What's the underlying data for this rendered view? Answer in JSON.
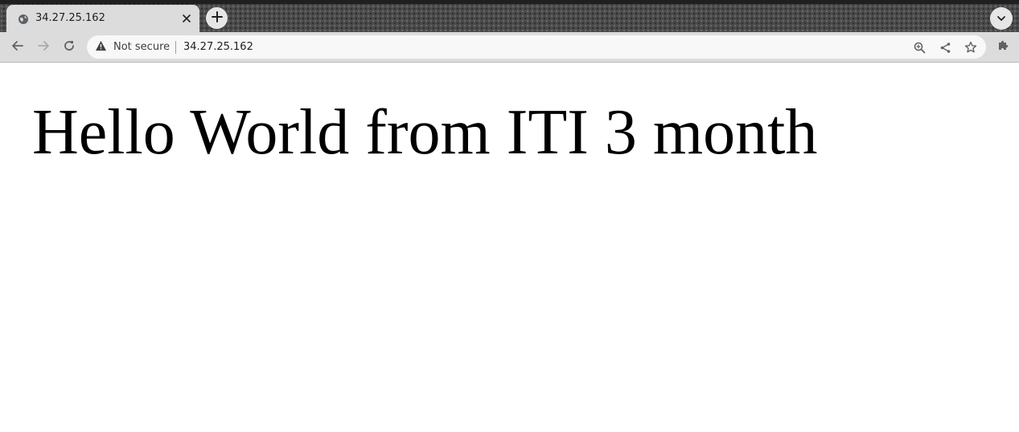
{
  "browser": {
    "tab": {
      "title": "34.27.25.162",
      "favicon": "globe-icon"
    },
    "new_tab_icon": "plus-icon",
    "tab_search_icon": "chevron-down-icon",
    "toolbar": {
      "back_icon": "arrow-left-icon",
      "forward_icon": "arrow-right-icon",
      "reload_icon": "reload-icon",
      "extensions_icon": "puzzle-icon"
    },
    "omnibox": {
      "security_icon": "warning-icon",
      "security_label": "Not secure",
      "url": "34.27.25.162",
      "zoom_icon": "zoom-in-icon",
      "share_icon": "share-icon",
      "bookmark_icon": "star-icon"
    }
  },
  "page": {
    "heading": "Hello World from ITI 3 month"
  },
  "colors": {
    "tab_active_bg": "#dcdcdc",
    "toolbar_bg": "#dcdcdc",
    "omnibox_bg": "#f8f8f8",
    "page_bg": "#ffffff",
    "text": "#000000"
  }
}
